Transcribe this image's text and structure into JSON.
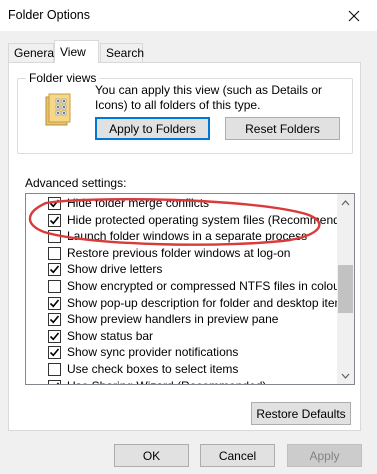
{
  "window": {
    "title": "Folder Options",
    "close_icon": "close-icon"
  },
  "tabs": [
    {
      "label": "General",
      "active": false
    },
    {
      "label": "View",
      "active": true
    },
    {
      "label": "Search",
      "active": false
    }
  ],
  "folder_views": {
    "label": "Folder views",
    "description": "You can apply this view (such as Details or Icons) to all folders of this type.",
    "icon": "folder-icon",
    "apply_button": "Apply to Folders",
    "reset_button": "Reset Folders"
  },
  "advanced": {
    "label": "Advanced settings:",
    "items": [
      {
        "label": "Hide folder merge conflicts",
        "checked": true
      },
      {
        "label": "Hide protected operating system files (Recommended)",
        "checked": true
      },
      {
        "label": "Launch folder windows in a separate process",
        "checked": false
      },
      {
        "label": "Restore previous folder windows at log-on",
        "checked": false
      },
      {
        "label": "Show drive letters",
        "checked": true
      },
      {
        "label": "Show encrypted or compressed NTFS files in colour",
        "checked": false
      },
      {
        "label": "Show pop-up description for folder and desktop items",
        "checked": true
      },
      {
        "label": "Show preview handlers in preview pane",
        "checked": true
      },
      {
        "label": "Show status bar",
        "checked": true
      },
      {
        "label": "Show sync provider notifications",
        "checked": true
      },
      {
        "label": "Use check boxes to select items",
        "checked": false
      },
      {
        "label": "Use Sharing Wizard (Recommended)",
        "checked": true
      }
    ],
    "restore_button": "Restore Defaults",
    "highlight_color": "#d93a3a"
  },
  "footer": {
    "ok": "OK",
    "cancel": "Cancel",
    "apply": "Apply"
  }
}
